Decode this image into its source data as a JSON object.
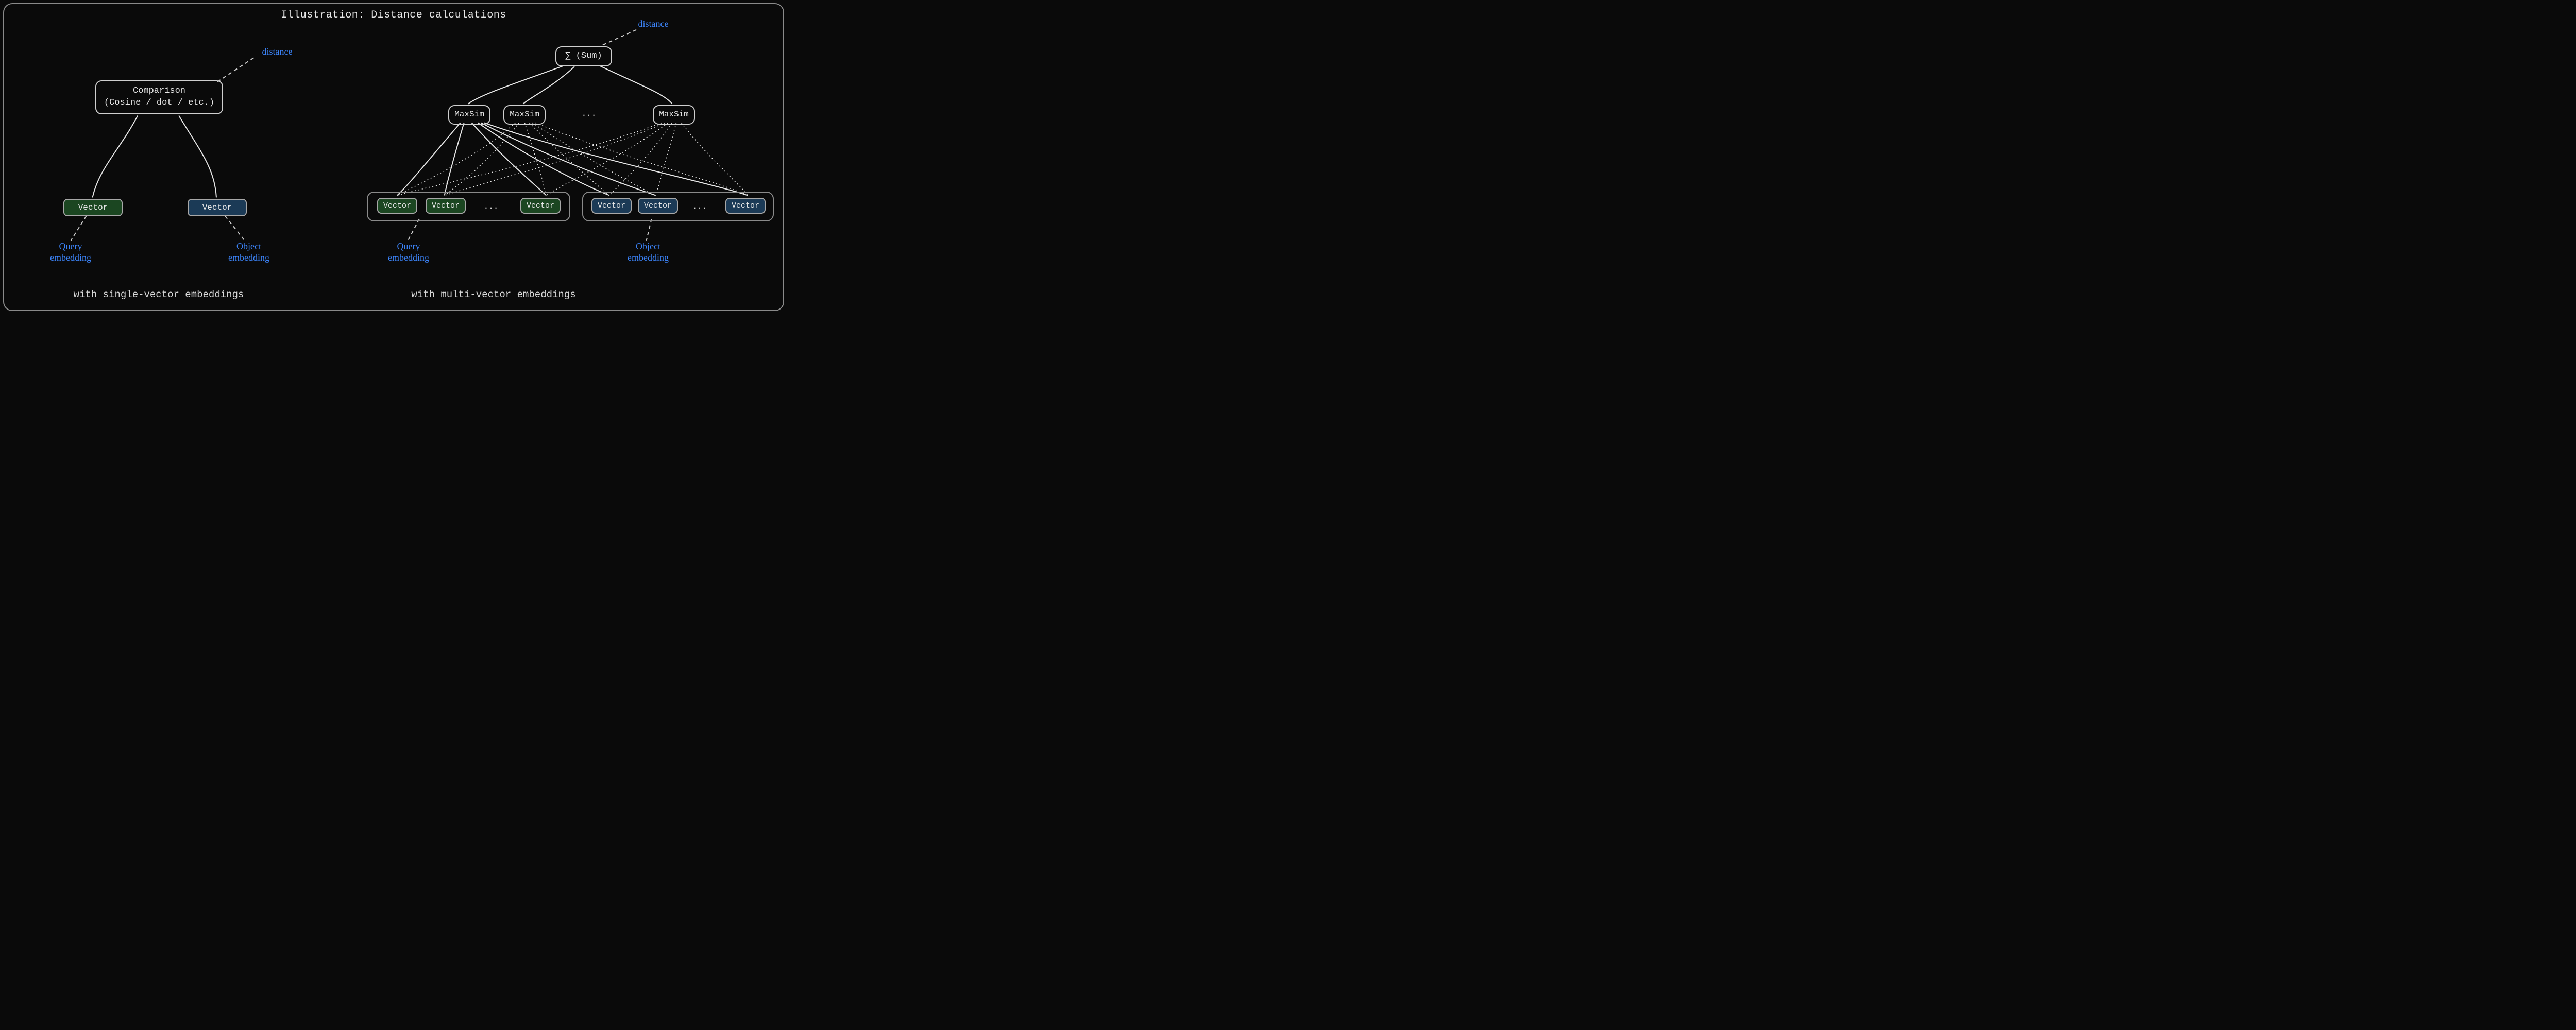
{
  "title": "Illustration: Distance calculations",
  "colors": {
    "green": "#1b4621",
    "blue": "#1b3a56",
    "annotation": "#3b82f6",
    "stroke": "#cfcfcf"
  },
  "left": {
    "comparison_line1": "Comparison",
    "comparison_line2": "(Cosine / dot / etc.)",
    "distance_label": "distance",
    "query_vector": "Vector",
    "object_vector": "Vector",
    "query_annotation_line1": "Query",
    "query_annotation_line2": "embedding",
    "object_annotation_line1": "Object",
    "object_annotation_line2": "embedding",
    "caption": "with single-vector embeddings"
  },
  "right": {
    "sum_label": "∑  (Sum)",
    "distance_label": "distance",
    "maxsim_label": "MaxSim",
    "ellipsis": "...",
    "query_vectors": [
      "Vector",
      "Vector",
      "Vector"
    ],
    "object_vectors": [
      "Vector",
      "Vector",
      "Vector"
    ],
    "query_annotation_line1": "Query",
    "query_annotation_line2": "embedding",
    "object_annotation_line1": "Object",
    "object_annotation_line2": "embedding",
    "caption": "with multi-vector embeddings"
  }
}
